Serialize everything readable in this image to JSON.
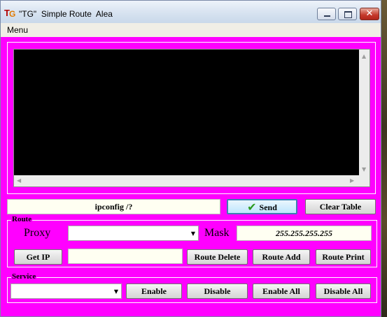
{
  "window": {
    "title": "\"TG\"  Simple Route  Alea",
    "icon_letters": [
      "T",
      "G"
    ],
    "controls": [
      "minimize",
      "maximize",
      "close"
    ],
    "close_glyph": "✕"
  },
  "menu": {
    "items": [
      "Menu"
    ]
  },
  "console": {
    "content": "",
    "background": "#000000"
  },
  "command": {
    "input_value": "ipconfig /?",
    "send_label": "Send",
    "clear_label": "Clear Table"
  },
  "route": {
    "group_label": "Route",
    "proxy_label": "Proxy",
    "proxy_value": "",
    "mask_label": "Mask",
    "mask_value": "255.255.255.255",
    "get_ip_label": "Get IP",
    "ip_value": "",
    "delete_label": "Route Delete",
    "add_label": "Route Add",
    "print_label": "Route Print"
  },
  "service": {
    "group_label": "Service",
    "selected": "",
    "enable_label": "Enable",
    "disable_label": "Disable",
    "enable_all_label": "Enable All",
    "disable_all_label": "Disable All"
  },
  "colors": {
    "client_background": "#ff00ff",
    "field_background": "#fffff2"
  }
}
